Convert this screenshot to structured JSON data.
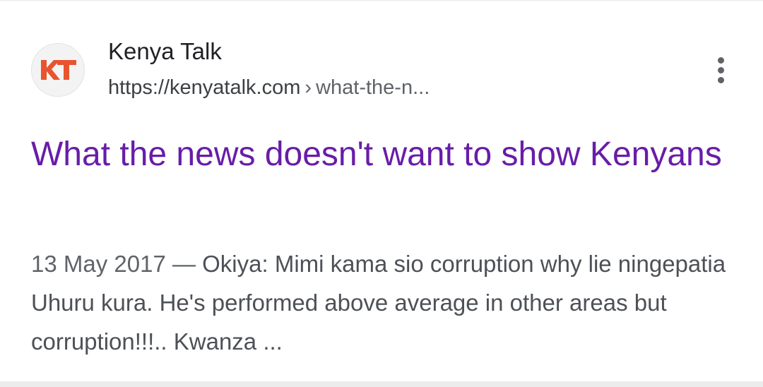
{
  "result": {
    "site_name": "Kenya Talk",
    "url_domain": "https://kenyatalk.com",
    "url_separator": "›",
    "url_path": "what-the-n...",
    "title": "What the news doesn't want to show Kenyans",
    "snippet_date": "13 May 2017 —",
    "snippet_text": "Okiya: Mimi kama sio corruption why lie ningepatia Uhuru kura. He's performed above average in other areas but corruption!!!.. Kwanza ...",
    "favicon_text": "KT",
    "favicon_color": "#e8542e"
  },
  "icons": {
    "favicon": "kenya-talk-logo-icon",
    "more": "more-vertical-icon"
  },
  "colors": {
    "title_visited": "#681da8",
    "text": "#202124",
    "muted": "#5f6368"
  }
}
